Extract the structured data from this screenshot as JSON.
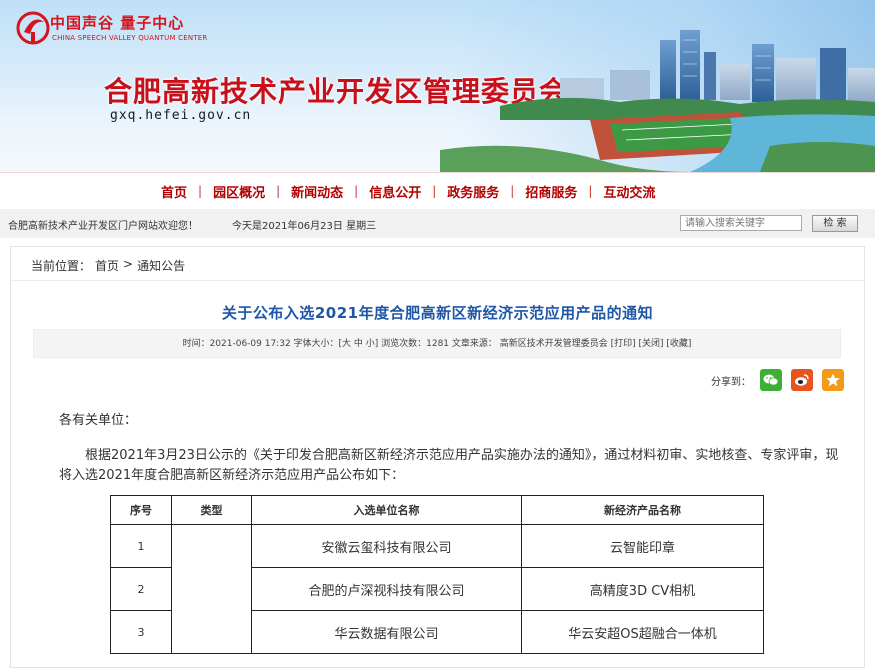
{
  "brand": {
    "logo_cn": "中国声谷 量子中心",
    "logo_en": "CHINA SPEECH VALLEY QUANTUM CENTER",
    "site_title": "合肥高新技术产业开发区管理委员会",
    "site_domain": "gxq.hefei.gov.cn",
    "title_color": "#c8101a"
  },
  "nav": {
    "items": [
      "首页",
      "园区概况",
      "新闻动态",
      "信息公开",
      "政务服务",
      "招商服务",
      "互动交流"
    ],
    "separator": "|",
    "color": "#b30000"
  },
  "infobar": {
    "welcome": "合肥高新技术产业开发区门户网站欢迎您！",
    "today": "今天是2021年06月23日  星期三",
    "search_placeholder": "请输入搜索关键字",
    "search_button": "检 索"
  },
  "breadcrumb": {
    "label": "当前位置：",
    "home": "首页",
    "sep": ">",
    "current": "通知公告"
  },
  "article": {
    "title": "关于公布入选2021年度合肥高新区新经济示范应用产品的通知",
    "meta": "时间：2021-06-09 17:32 字体大小：[大  中  小] 浏览次数：1281 文章来源：  高新区技术开发管理委员会 [打印] [关闭] [收藏]",
    "share_label": "分享到：",
    "share_icons": [
      "wechat-icon",
      "weibo-icon",
      "favorite-icon"
    ],
    "greeting": "各有关单位：",
    "body": "根据2021年3月23日公示的《关于印发合肥高新区新经济示范应用产品实施办法的通知》，通过材料初审、实地核查、专家评审，现将入选2021年度合肥高新区新经济示范应用产品公布如下："
  },
  "table": {
    "headers": [
      "序号",
      "类型",
      "入选单位名称",
      "新经济产品名称"
    ],
    "rows": [
      {
        "no": "1",
        "type": "",
        "company": "安徽云玺科技有限公司",
        "product": "云智能印章"
      },
      {
        "no": "2",
        "type": "",
        "company": "合肥的卢深视科技有限公司",
        "product": "高精度3D CV相机"
      },
      {
        "no": "3",
        "type": "",
        "company": "华云数据有限公司",
        "product": "华云安超OS超融合一体机"
      }
    ]
  }
}
